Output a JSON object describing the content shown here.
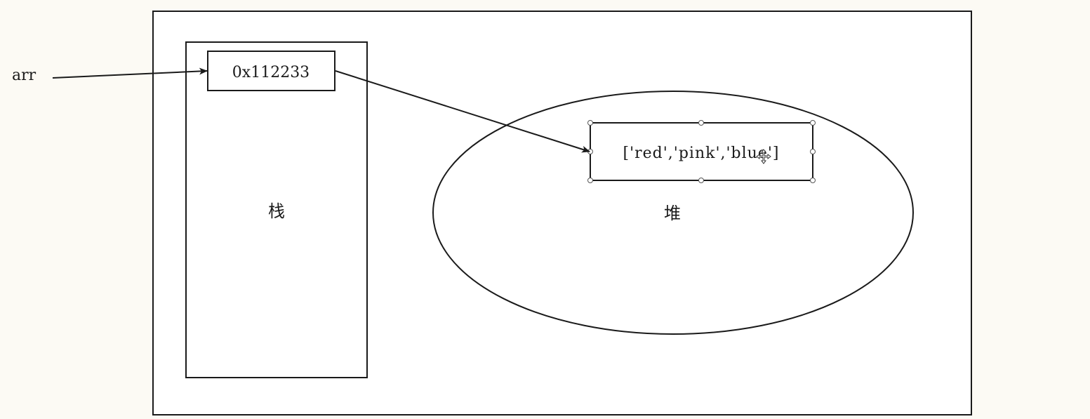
{
  "variable": {
    "name": "arr"
  },
  "stack": {
    "title": "栈",
    "address": "0x112233"
  },
  "heap": {
    "title": "堆",
    "array_literal": "['red','pink','blue']"
  },
  "colors": {
    "background": "#fcfaf4",
    "stroke": "#1a1a1a",
    "panel": "#ffffff"
  }
}
